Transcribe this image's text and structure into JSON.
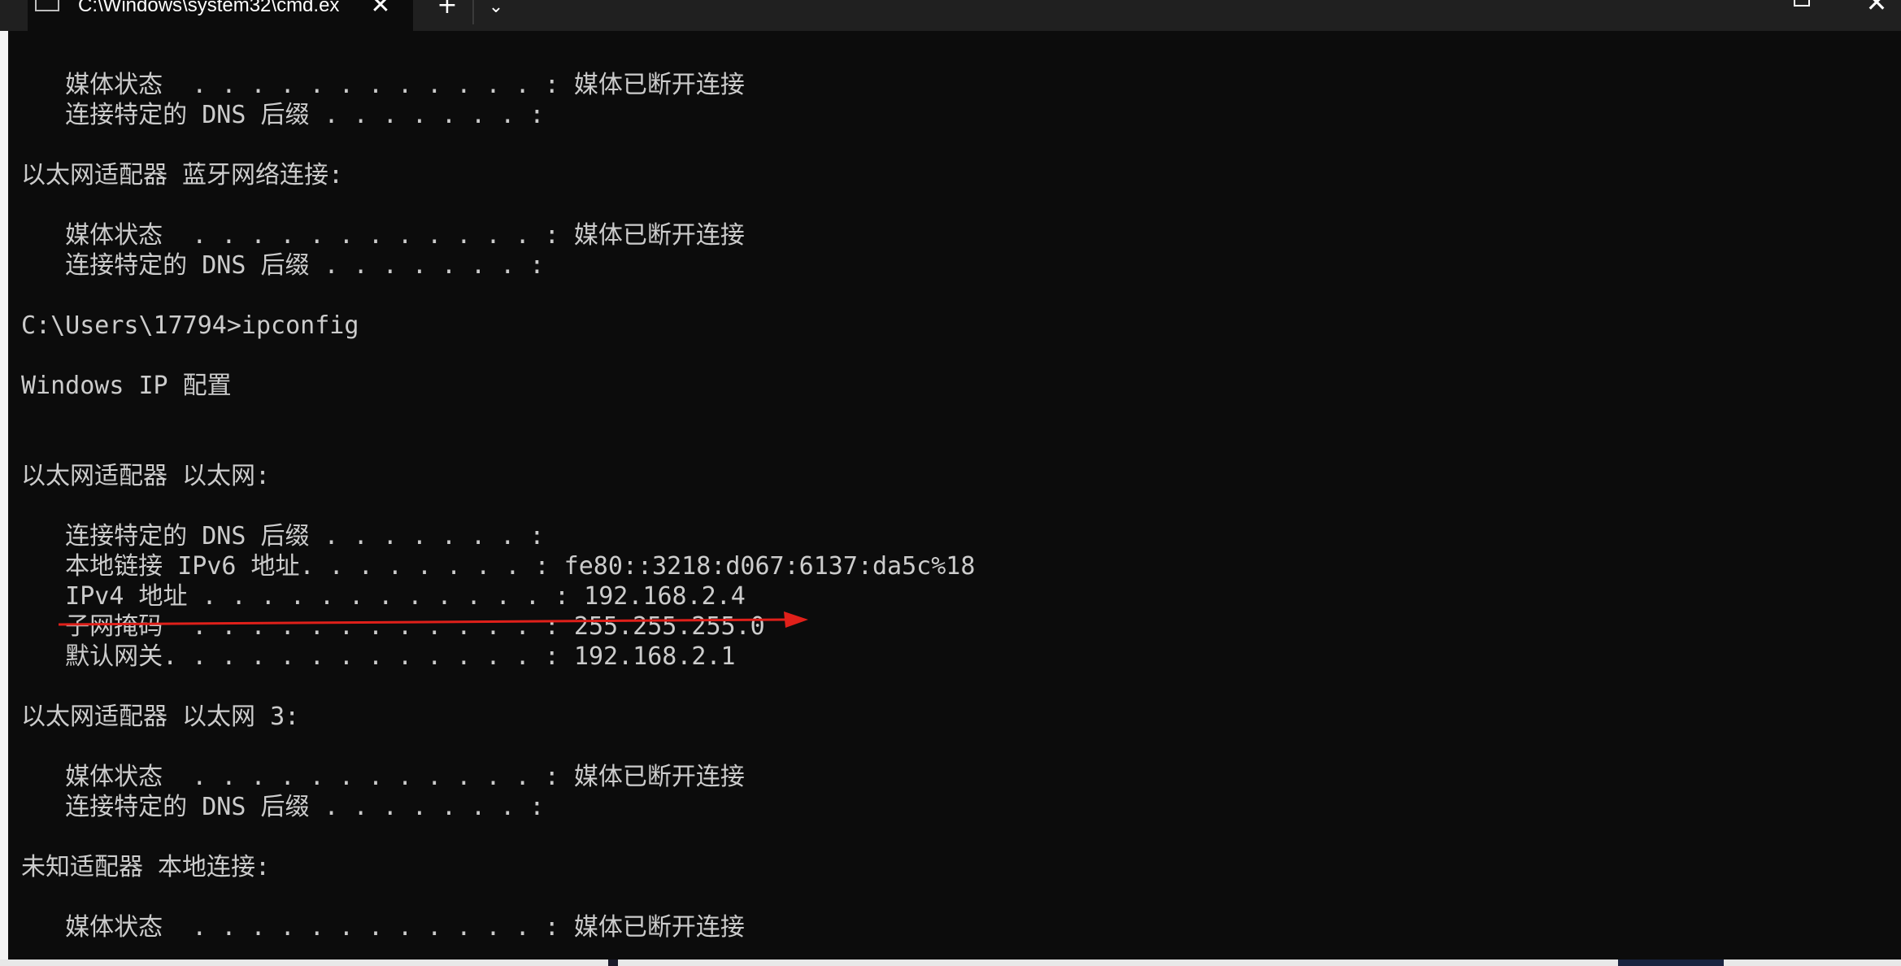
{
  "window": {
    "tab_title": "C:\\Windows\\system32\\cmd.ex",
    "tab_close_glyph": "✕",
    "new_tab_glyph": "+",
    "dropdown_glyph": "⌄",
    "close_glyph": "✕",
    "tab_icon": "console-icon"
  },
  "console": {
    "text_color": "#cccccc",
    "background": "#0c0c0c",
    "lines": [
      "   媒体状态  . . . . . . . . . . . . : 媒体已断开连接",
      "   连接特定的 DNS 后缀 . . . . . . . :",
      "",
      "以太网适配器 蓝牙网络连接:",
      "",
      "   媒体状态  . . . . . . . . . . . . : 媒体已断开连接",
      "   连接特定的 DNS 后缀 . . . . . . . :",
      "",
      "C:\\Users\\17794>ipconfig",
      "",
      "Windows IP 配置",
      "",
      "",
      "以太网适配器 以太网:",
      "",
      "   连接特定的 DNS 后缀 . . . . . . . :",
      "   本地链接 IPv6 地址. . . . . . . . : fe80::3218:d067:6137:da5c%18",
      "   IPv4 地址 . . . . . . . . . . . . : 192.168.2.4",
      "   子网掩码  . . . . . . . . . . . . : 255.255.255.0",
      "   默认网关. . . . . . . . . . . . . : 192.168.2.1",
      "",
      "以太网适配器 以太网 3:",
      "",
      "   媒体状态  . . . . . . . . . . . . : 媒体已断开连接",
      "   连接特定的 DNS 后缀 . . . . . . . :",
      "",
      "未知适配器 本地连接:",
      "",
      "   媒体状态  . . . . . . . . . . . . : 媒体已断开连接"
    ]
  },
  "annotation": {
    "color": "#e0201a"
  }
}
